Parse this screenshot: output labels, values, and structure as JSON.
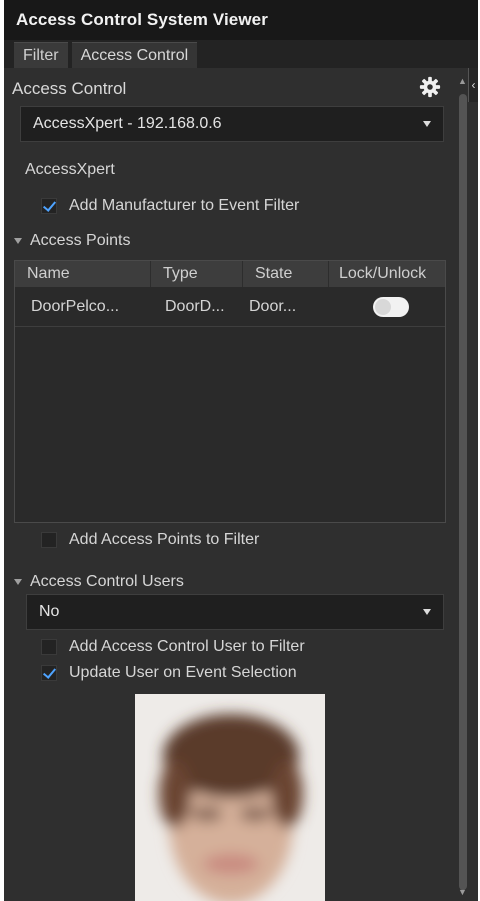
{
  "window": {
    "title": "Access Control System Viewer"
  },
  "tabs": [
    {
      "label": "Filter",
      "active": false
    },
    {
      "label": "Access Control",
      "active": true
    }
  ],
  "access_control": {
    "heading": "Access Control",
    "settings_icon": "gear-icon",
    "system_selected": "AccessXpert - 192.168.0.6",
    "manufacturer": "AccessXpert",
    "add_manufacturer_label": "Add Manufacturer to Event Filter",
    "add_manufacturer_checked": true
  },
  "access_points": {
    "heading": "Access Points",
    "columns": [
      "Name",
      "Type",
      "State",
      "Lock/Unlock"
    ],
    "rows": [
      {
        "name": "DoorPelco...",
        "type": "DoorD...",
        "state": "Door...",
        "lock_unlock": "toggle"
      }
    ],
    "add_to_filter_label": "Add Access Points to Filter",
    "add_to_filter_checked": false
  },
  "users": {
    "heading": "Access Control Users",
    "selected": "No",
    "add_user_label": "Add Access Control User to Filter",
    "add_user_checked": false,
    "update_on_selection_label": "Update User on Event Selection",
    "update_on_selection_checked": true
  },
  "colors": {
    "panel_bg": "#2f2f2f",
    "titlebar_bg": "#181818",
    "check_accent": "#4ea3ff"
  }
}
